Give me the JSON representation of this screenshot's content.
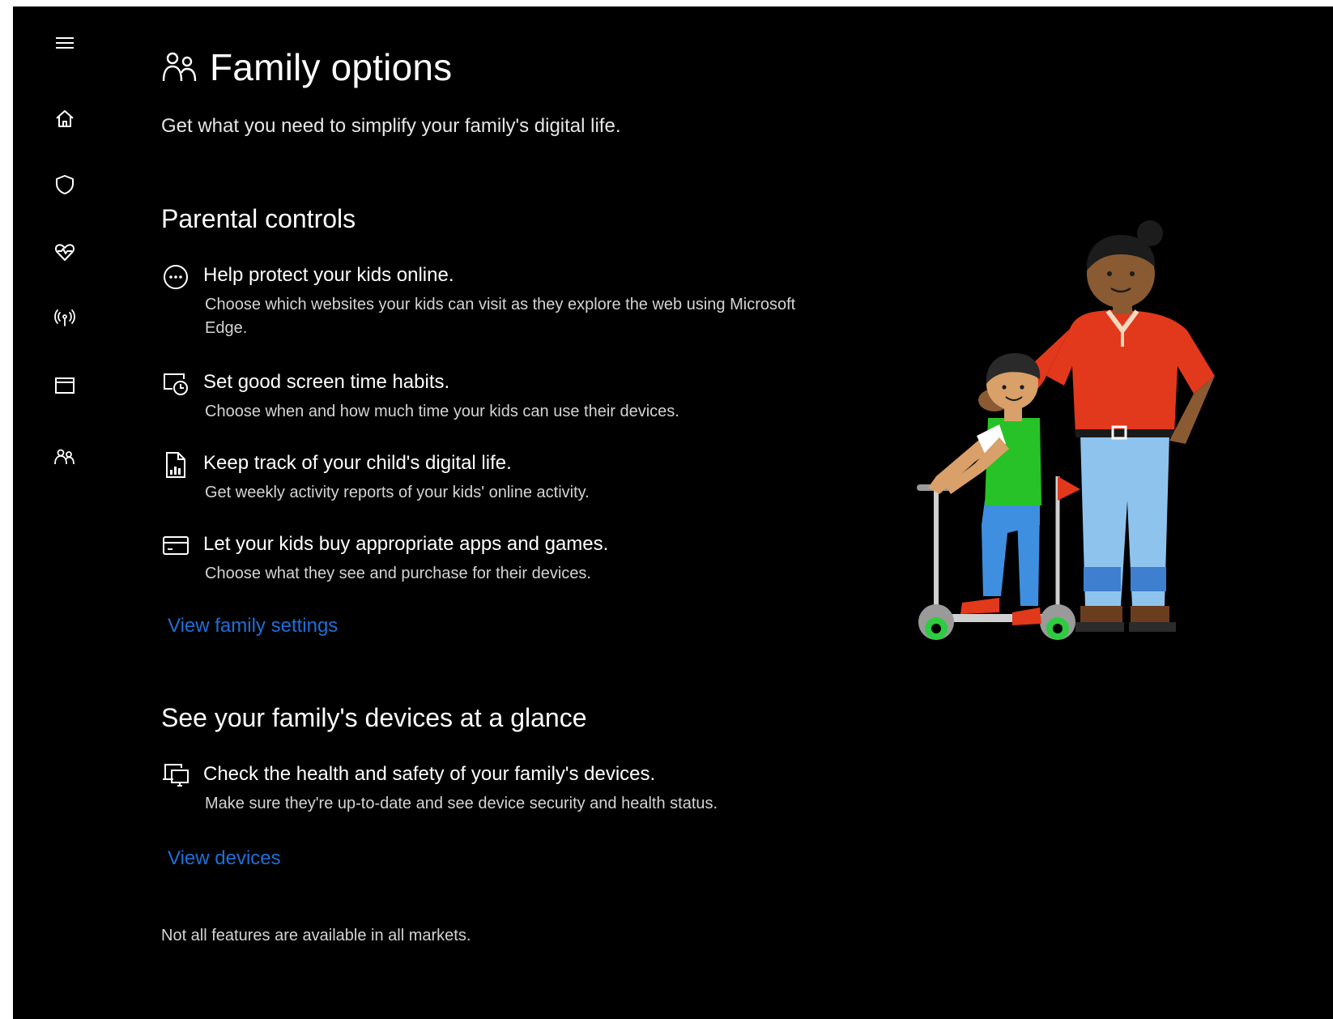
{
  "app": {
    "page_title": "Family options",
    "subtitle": "Get what you need to simplify your family's digital life."
  },
  "nav": {
    "items": [
      {
        "name": "menu",
        "icon": "hamburger-menu-icon"
      },
      {
        "name": "home",
        "icon": "home-icon"
      },
      {
        "name": "virus-protection",
        "icon": "shield-icon"
      },
      {
        "name": "device-health",
        "icon": "heartbeat-icon"
      },
      {
        "name": "firewall-network",
        "icon": "wireless-antenna-icon"
      },
      {
        "name": "app-browser-control",
        "icon": "browser-window-icon"
      },
      {
        "name": "family-options",
        "icon": "family-icon"
      }
    ]
  },
  "parental": {
    "heading": "Parental controls",
    "features": [
      {
        "icon": "smiley-face-icon",
        "title": "Help protect your kids online.",
        "desc": "Choose which websites your kids can visit as they explore the web using Microsoft Edge."
      },
      {
        "icon": "screen-time-clock-icon",
        "title": "Set good screen time habits.",
        "desc": "Choose when and how much time your kids can use their devices."
      },
      {
        "icon": "activity-report-icon",
        "title": "Keep track of your child's digital life.",
        "desc": "Get weekly activity reports of your kids' online activity."
      },
      {
        "icon": "credit-card-icon",
        "title": "Let your kids buy appropriate apps and games.",
        "desc": "Choose what they see and purchase for their devices."
      }
    ],
    "link": "View family settings"
  },
  "devices": {
    "heading": "See your family's devices at a glance",
    "features": [
      {
        "icon": "devices-icon",
        "title": "Check the health and safety of your family's devices.",
        "desc": "Make sure they're up-to-date and see device security and health status."
      }
    ],
    "link": "View devices"
  },
  "footnote": "Not all features are available in all markets.",
  "colors": {
    "background": "#000000",
    "text": "#ffffff",
    "secondary_text": "#d4d4d4",
    "link": "#1e6fd9"
  }
}
